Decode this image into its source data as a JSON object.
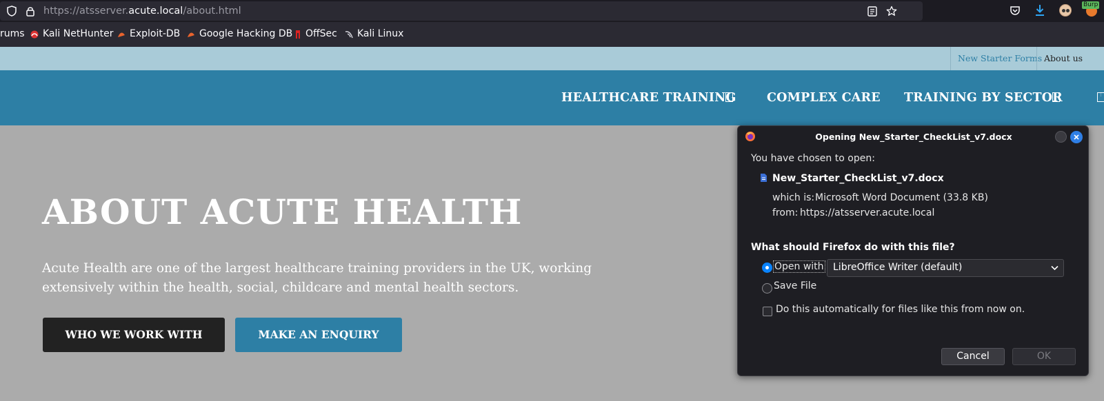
{
  "browser": {
    "url_prefix": "https://atsserver.",
    "url_host": "acute.local",
    "url_path": "/about.html",
    "burp_badge": "Burp",
    "bookmarks": [
      {
        "label": "rums"
      },
      {
        "label": "Kali NetHunter"
      },
      {
        "label": "Exploit-DB"
      },
      {
        "label": "Google Hacking DB"
      },
      {
        "label": "OffSec"
      },
      {
        "label": "Kali Linux"
      }
    ]
  },
  "site": {
    "top_links": {
      "new_starter": "New Starter Forms",
      "about": "About us"
    },
    "nav": {
      "healthcare": "HEALTHCARE TRAINING",
      "complex": "COMPLEX CARE",
      "sector": "TRAINING BY SECTOR"
    },
    "hero": {
      "title": "ABOUT ACUTE HEALTH",
      "description": "Acute Health are one of the largest healthcare training providers in the UK, working extensively within the health, social, childcare and mental health sectors.",
      "btn_work": "WHO WE WORK WITH",
      "btn_enquiry": "MAKE AN ENQUIRY"
    }
  },
  "dialog": {
    "title": "Opening New_Starter_CheckList_v7.docx",
    "intro": "You have chosen to open:",
    "filename": "New_Starter_CheckList_v7.docx",
    "which_is_label": "which is:",
    "which_is_value": "Microsoft Word Document (33.8 KB)",
    "from_label": "from:",
    "from_value": "https://atsserver.acute.local",
    "question": "What should Firefox do with this file?",
    "open_with_label": "Open with",
    "open_with_app": "LibreOffice Writer (default)",
    "save_file_label": "Save File",
    "auto_label": "Do this automatically for files like this from now on.",
    "cancel": "Cancel",
    "ok": "OK"
  },
  "colors": {
    "nav_bg": "#2d7fa5",
    "top_strip_bg": "#a9cbd8",
    "page_overlay": "#ababab",
    "btn_dark": "#222222",
    "btn_blue": "#2d7fa5",
    "dialog_bg": "#1e1e23",
    "radio_accent": "#0a84ff"
  }
}
